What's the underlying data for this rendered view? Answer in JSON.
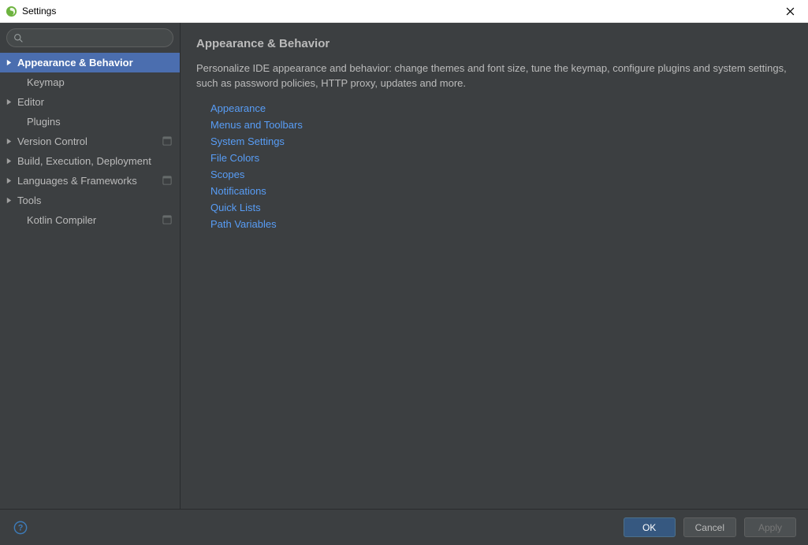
{
  "window": {
    "title": "Settings"
  },
  "search": {
    "value": "",
    "placeholder": ""
  },
  "sidebar": {
    "items": [
      {
        "label": "Appearance & Behavior",
        "expandable": true,
        "selected": true,
        "projectIcon": false
      },
      {
        "label": "Keymap",
        "expandable": false,
        "selected": false,
        "projectIcon": false
      },
      {
        "label": "Editor",
        "expandable": true,
        "selected": false,
        "projectIcon": false
      },
      {
        "label": "Plugins",
        "expandable": false,
        "selected": false,
        "projectIcon": false
      },
      {
        "label": "Version Control",
        "expandable": true,
        "selected": false,
        "projectIcon": true
      },
      {
        "label": "Build, Execution, Deployment",
        "expandable": true,
        "selected": false,
        "projectIcon": false
      },
      {
        "label": "Languages & Frameworks",
        "expandable": true,
        "selected": false,
        "projectIcon": true
      },
      {
        "label": "Tools",
        "expandable": true,
        "selected": false,
        "projectIcon": false
      },
      {
        "label": "Kotlin Compiler",
        "expandable": false,
        "selected": false,
        "projectIcon": true
      }
    ]
  },
  "main": {
    "title": "Appearance & Behavior",
    "description": "Personalize IDE appearance and behavior: change themes and font size, tune the keymap, configure plugins and system settings, such as password policies, HTTP proxy, updates and more.",
    "links": [
      "Appearance",
      "Menus and Toolbars",
      "System Settings",
      "File Colors",
      "Scopes",
      "Notifications",
      "Quick Lists",
      "Path Variables"
    ]
  },
  "footer": {
    "ok": "OK",
    "cancel": "Cancel",
    "apply": "Apply"
  }
}
